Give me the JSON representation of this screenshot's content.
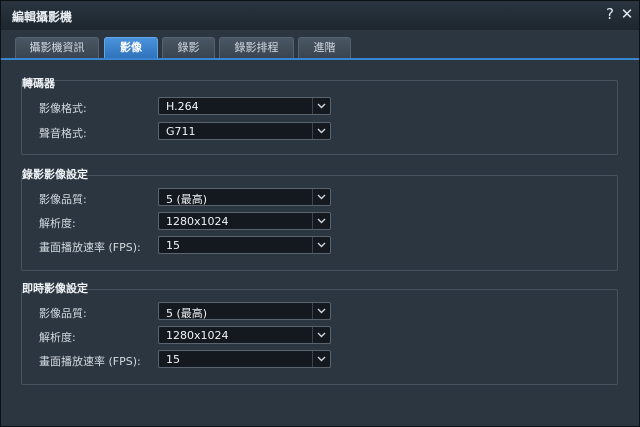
{
  "dialog": {
    "title": "編輯攝影機",
    "help_glyph": "?",
    "close_glyph": "✕"
  },
  "tabs": [
    {
      "label": "攝影機資訊",
      "active": false
    },
    {
      "label": "影像",
      "active": true
    },
    {
      "label": "錄影",
      "active": false
    },
    {
      "label": "錄影排程",
      "active": false
    },
    {
      "label": "進階",
      "active": false
    }
  ],
  "codec": {
    "title": "轉碼器",
    "video_format": {
      "label": "影像格式:",
      "value": "H.264"
    },
    "audio_format": {
      "label": "聲音格式:",
      "value": "G711"
    }
  },
  "recording": {
    "title": "錄影影像設定",
    "quality": {
      "label": "影像品質:",
      "value": "5 (最高)"
    },
    "resolution": {
      "label": "解析度:",
      "value": "1280x1024"
    },
    "fps": {
      "label": "畫面播放速率 (FPS):",
      "value": "15"
    }
  },
  "live": {
    "title": "即時影像設定",
    "quality": {
      "label": "影像品質:",
      "value": "5 (最高)"
    },
    "resolution": {
      "label": "解析度:",
      "value": "1280x1024"
    },
    "fps": {
      "label": "畫面播放速率 (FPS):",
      "value": "15"
    }
  },
  "colors": {
    "accent": "#3a85cf",
    "panel": "#2c3640",
    "field": "#14191f"
  },
  "icons": {
    "dropdown": "chevron-down-icon",
    "help": "help-icon",
    "close": "close-icon"
  }
}
